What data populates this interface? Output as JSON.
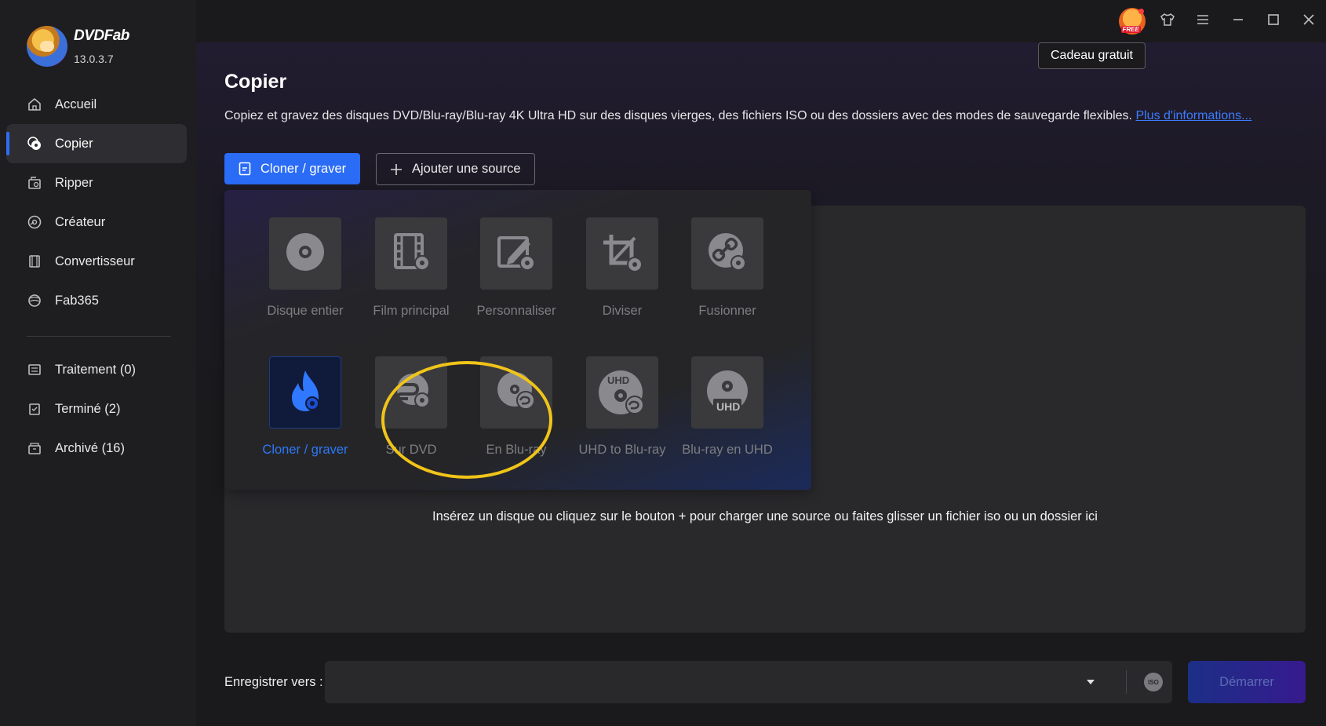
{
  "app": {
    "name": "DVDFab",
    "version": "13.0.3.7"
  },
  "sidebar": {
    "items": [
      {
        "label": "Accueil",
        "icon": "home-icon"
      },
      {
        "label": "Copier",
        "icon": "copy-disc-icon",
        "active": true
      },
      {
        "label": "Ripper",
        "icon": "ripper-icon"
      },
      {
        "label": "Créateur",
        "icon": "creator-icon"
      },
      {
        "label": "Convertisseur",
        "icon": "converter-icon"
      },
      {
        "label": "Fab365",
        "icon": "fab365-icon"
      }
    ],
    "queue": [
      {
        "label": "Traitement (0)",
        "icon": "processing-icon"
      },
      {
        "label": "Terminé (2)",
        "icon": "finished-icon"
      },
      {
        "label": "Archivé (16)",
        "icon": "archive-icon"
      }
    ]
  },
  "titlebar": {
    "gift_badge_text": "FREE",
    "tooltip": "Cadeau gratuit",
    "icons": [
      "gift-icon",
      "shirt-icon",
      "menu-icon",
      "minimize-icon",
      "maximize-icon",
      "close-icon"
    ]
  },
  "page": {
    "title": "Copier",
    "description": "Copiez et gravez des disques DVD/Blu-ray/Blu-ray 4K Ultra HD sur des disques vierges, des fichiers ISO ou des dossiers avec des modes de sauvegarde flexibles.",
    "more_link": "Plus d'informations..."
  },
  "toolbar": {
    "mode_button": "Cloner / graver",
    "add_source_button": "Ajouter une source"
  },
  "modes": [
    {
      "label": "Disque entier",
      "icon": "disc-icon"
    },
    {
      "label": "Film principal",
      "icon": "film-icon"
    },
    {
      "label": "Personnaliser",
      "icon": "customize-icon"
    },
    {
      "label": "Diviser",
      "icon": "split-icon"
    },
    {
      "label": "Fusionner",
      "icon": "merge-icon"
    },
    {
      "label": "Cloner / graver",
      "icon": "flame-icon",
      "selected": true
    },
    {
      "label": "Sur DVD",
      "icon": "to-dvd-icon"
    },
    {
      "label": "En Blu-ray",
      "icon": "to-bluray-icon"
    },
    {
      "label": "UHD to Blu-ray",
      "icon": "uhd-to-bluray-icon",
      "uhd_text": "UHD"
    },
    {
      "label": "Blu-ray en UHD",
      "icon": "bluray-to-uhd-icon",
      "uhd_text": "UHD"
    }
  ],
  "drop_hint": "Insérez un disque ou cliquez sur le bouton +  pour charger une source ou faites glisser un fichier iso ou un dossier ici",
  "footer": {
    "save_label": "Enregistrer vers :",
    "save_value": "",
    "iso_badge": "ISO",
    "start_button": "Démarrer"
  },
  "colors": {
    "accent": "#2a6cf6",
    "highlight_ring": "#f0c419",
    "selected_label": "#2d78f6"
  }
}
